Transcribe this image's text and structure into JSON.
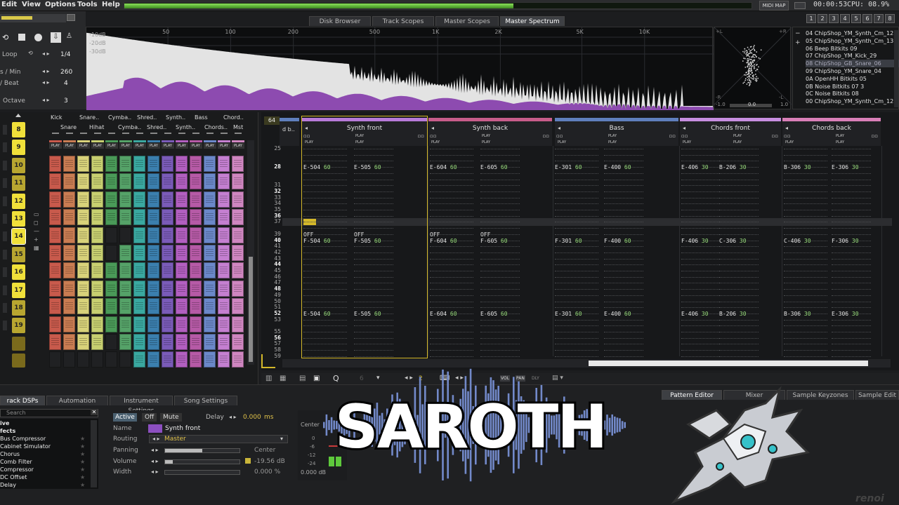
{
  "menu": {
    "edit": "Edit",
    "view": "View",
    "options": "Options",
    "tools": "Tools",
    "help": "Help"
  },
  "status": {
    "midi_map": "MIDI MAP",
    "time": "00:00:53",
    "cpu": "CPU: 08.9%",
    "peak_level": 0.62
  },
  "top_buttons": [
    "1",
    "2",
    "3",
    "4",
    "5",
    "6",
    "7",
    "8"
  ],
  "transport": {
    "loop_label": "Loop",
    "loop_value": "1/4",
    "lpm_label": "s / Min",
    "lpm_value": "260",
    "lpb_label": "/ Beat",
    "lpb_value": "4",
    "octave_label": "Octave",
    "octave_value": "3"
  },
  "upper_tabs": [
    "Disk Browser",
    "Track Scopes",
    "Master Scopes",
    "Master Spectrum"
  ],
  "spectrum": {
    "db_labels": [
      "-10dB",
      "-20dB",
      "-30dB"
    ],
    "freq_labels": [
      "50",
      "100",
      "200",
      "500",
      "1K",
      "2K",
      "5K",
      "10K"
    ],
    "colors": {
      "fill": "#8d4bb0",
      "white": "#e3e3e3"
    }
  },
  "scope": {
    "l": "+L",
    "r": "+R",
    "minus_r": "-R",
    "minus_l": "-L",
    "value": "-1.0",
    "mid": "0.0",
    "max": "1.0"
  },
  "instruments": [
    {
      "num": "04",
      "name": "ChipShop_YM_Synth_Cm_12"
    },
    {
      "num": "05",
      "name": "ChipShop_YM_Synth_Cm_13"
    },
    {
      "num": "06",
      "name": "Beep Bitkits 09"
    },
    {
      "num": "07",
      "name": "ChipShop_YM_Kick_29"
    },
    {
      "num": "08",
      "name": "ChipShop_GB_Snare_06"
    },
    {
      "num": "09",
      "name": "ChipShop_YM_Snare_04"
    },
    {
      "num": "0A",
      "name": "OpenHH Bitkits 05"
    },
    {
      "num": "0B",
      "name": "Noise Bitkits 07 3"
    },
    {
      "num": "0C",
      "name": "Noise Bitkits 08"
    },
    {
      "num": "00",
      "name": "ChipShop_YM_Synth_Cm_12"
    }
  ],
  "sequence": [
    "8",
    "9",
    "10",
    "11",
    "12",
    "13",
    "14",
    "15",
    "16",
    "17",
    "18",
    "19"
  ],
  "matrix_tracks_top": [
    "Kick",
    "Snare..",
    "Cymba..",
    "Shred..",
    "Synth..",
    "Bass",
    "Chord.."
  ],
  "matrix_tracks_bottom": [
    "Snare",
    "Hihat",
    "Cymba..",
    "Shred..",
    "Synth..",
    "Chords..",
    "Mst"
  ],
  "play_label": "PLAY",
  "matrix_colors": [
    "#c85a4c",
    "#c97c52",
    "#d8d27a",
    "#c7cf70",
    "#4a9a58",
    "#55a268",
    "#3aa8a0",
    "#3b7fae",
    "#7a5bb8",
    "#b25fc0",
    "#b65aa6",
    "#6b88c9",
    "#c47fd0",
    "#cf86c0"
  ],
  "pattern": {
    "length": "64",
    "current_row": "37",
    "tracks": [
      {
        "name": "Synth front",
        "color": "#b77ad8"
      },
      {
        "name": "Synth back",
        "color": "#c85c8a"
      },
      {
        "name": "Bass",
        "color": "#5f7fbd"
      },
      {
        "name": "Chords front",
        "color": "#c78ee0"
      },
      {
        "name": "Chords back",
        "color": "#d97fb8"
      }
    ],
    "first_track_partial": "d b..",
    "rows": [
      "25",
      "28",
      "31",
      "32",
      "33",
      "34",
      "35",
      "36",
      "37",
      "39",
      "40",
      "41",
      "42",
      "43",
      "44",
      "45",
      "46",
      "47",
      "48",
      "49",
      "50",
      "51",
      "52",
      "53",
      "55",
      "56",
      "57",
      "58",
      "59"
    ],
    "row28": [
      {
        "n": "E-5",
        "i": "04",
        "v": "60"
      },
      {
        "n": "E-5",
        "i": "05",
        "v": "60"
      },
      {
        "n": "E-6",
        "i": "04",
        "v": "60"
      },
      {
        "n": "E-6",
        "i": "05",
        "v": "60"
      },
      {
        "n": "E-3",
        "i": "01",
        "v": "60"
      },
      {
        "n": "E-4",
        "i": "00",
        "v": "60"
      },
      {
        "n": "E-4",
        "i": "06",
        "v": "30"
      },
      {
        "n": "B-2",
        "i": "06",
        "v": "30"
      },
      {
        "n": "B-3",
        "i": "06",
        "v": "30"
      },
      {
        "n": "E-3",
        "i": "06",
        "v": "30"
      }
    ],
    "row40": [
      {
        "n": "F-5",
        "i": "04",
        "v": "60"
      },
      {
        "n": "F-5",
        "i": "05",
        "v": "60"
      },
      {
        "n": "F-6",
        "i": "04",
        "v": "60"
      },
      {
        "n": "F-6",
        "i": "05",
        "v": "60"
      },
      {
        "n": "F-3",
        "i": "01",
        "v": "60"
      },
      {
        "n": "F-4",
        "i": "00",
        "v": "60"
      },
      {
        "n": "F-4",
        "i": "06",
        "v": "30"
      },
      {
        "n": "C-3",
        "i": "06",
        "v": "30"
      },
      {
        "n": "C-4",
        "i": "06",
        "v": "30"
      },
      {
        "n": "F-3",
        "i": "06",
        "v": "30"
      }
    ],
    "row52": [
      {
        "n": "E-5",
        "i": "04",
        "v": "60"
      },
      {
        "n": "E-5",
        "i": "05",
        "v": "60"
      },
      {
        "n": "E-6",
        "i": "04",
        "v": "60"
      },
      {
        "n": "E-6",
        "i": "05",
        "v": "60"
      },
      {
        "n": "E-3",
        "i": "01",
        "v": "60"
      },
      {
        "n": "E-4",
        "i": "00",
        "v": "60"
      },
      {
        "n": "E-4",
        "i": "06",
        "v": "30"
      },
      {
        "n": "B-2",
        "i": "06",
        "v": "30"
      },
      {
        "n": "B-3",
        "i": "06",
        "v": "30"
      },
      {
        "n": "E-3",
        "i": "06",
        "v": "30"
      }
    ],
    "off_label": "OFF"
  },
  "pattern_toolbar": {
    "octave": "6",
    "edit_step": "2",
    "vol_label": "VOL",
    "pan_label": "PAN",
    "dly_label": "DLY"
  },
  "bottom_tabs_left": [
    "rack DSPs",
    "Automation",
    "Instrument Settings",
    "Song Settings"
  ],
  "bottom_tabs_right": [
    "Pattern Editor",
    "Mixer",
    "Sample Keyzones",
    "Sample Edit"
  ],
  "dsp": {
    "search_placeholder": "Search",
    "items": [
      "ive",
      "fects",
      "Bus Compressor",
      "Cabinet Simulator",
      "Chorus",
      "Comb Filter",
      "Compressor",
      "DC Offset",
      "Delay"
    ]
  },
  "track_props": {
    "active": "Active",
    "off": "Off",
    "mute": "Mute",
    "delay_label": "Delay",
    "delay_value": "0.000",
    "delay_unit": "ms",
    "name_label": "Name",
    "name_value": "Synth front",
    "routing_label": "Routing",
    "routing_value": "Master",
    "panning_label": "Panning",
    "panning_value": "Center",
    "volume_label": "Volume",
    "volume_value": "-19.56 dB",
    "width_label": "Width",
    "width_value": "0.000 %",
    "panning_level": 0.5,
    "volume_level": 0.1,
    "width_level": 0.0
  },
  "meter": {
    "center_label": "Center",
    "scale": [
      "0",
      "-6",
      "-12",
      "-24"
    ],
    "db_value": "0.000 dB"
  },
  "logo_text": "SAROTH",
  "watermark": "renoi"
}
